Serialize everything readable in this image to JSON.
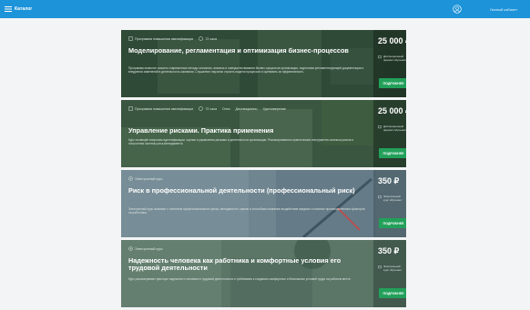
{
  "header": {
    "menu_label": "Каталог",
    "cabinet_label": "Личный кабинет"
  },
  "colors": {
    "header_bg": "#1d93d9",
    "buy_button": "#22a05a"
  },
  "courses": [
    {
      "meta_primary": "Программа повышения квалификации",
      "meta_items": [
        "72 часа"
      ],
      "title": "Моделирование, регламентация и оптимизация бизнес-процессов",
      "desc": "Программа позволит освоить современные методы описания, анализа и совершенствования бизнес-процессов организации, подготовки регламентирующей документации и внедрения изменений в деятельность компании. Слушатели научатся строить модели процессов и оценивать их эффективность.",
      "price": "25 000 ₽",
      "note": "Дистанционный формат обучения",
      "button": "ПОДРОБНЕЕ"
    },
    {
      "meta_primary": "Программа повышения квалификации",
      "meta_items": [
        "72 часа",
        "Очно",
        "Дистанционно",
        "Удостоверение"
      ],
      "title": "Управление рисками. Практика применения",
      "desc": "Курс посвящён вопросам идентификации, оценки и управления рисками в деятельности организации. Рассматриваются практические инструменты анализа рисков и построения системы риск-менеджмента.",
      "price": "25 000 ₽",
      "note": "Дистанционный формат обучения",
      "button": "ПОДРОБНЕЕ"
    },
    {
      "meta_primary": "Электронный курс",
      "meta_items": [],
      "title": "Риск в профессиональной деятельности (профессиональный риск)",
      "desc": "Электронный курс знакомит с понятием профессионального риска, методами его оценки и способами снижения воздействия вредных и опасных производственных факторов на работника.",
      "price": "350 ₽",
      "note": "Электронный курс обучения",
      "button": "ПОДРОБНЕЕ"
    },
    {
      "meta_primary": "Электронный курс",
      "meta_items": [],
      "title": "Надежность человека как работника и комфортные условия его трудовой деятельности",
      "desc": "Курс рассматривает факторы надежности человека в трудовой деятельности и требования к созданию комфортных и безопасных условий труда на рабочем месте.",
      "price": "350 ₽",
      "note": "Электронный курс обучения",
      "button": "ПОДРОБНЕЕ"
    }
  ]
}
